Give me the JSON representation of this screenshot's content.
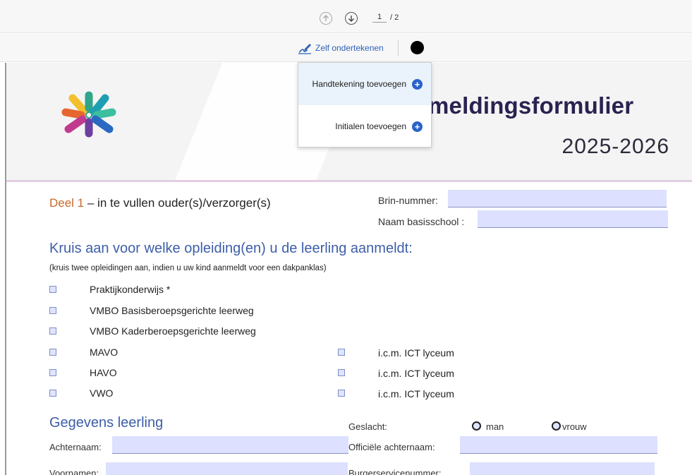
{
  "toolbar": {
    "page_current": "1",
    "page_total": "/ 2",
    "sign_label": "Zelf ondertekenen",
    "ink_color": "#000000"
  },
  "sign_menu": {
    "items": [
      {
        "label": "Handtekening toevoegen"
      },
      {
        "label": "Initialen toevoegen"
      }
    ]
  },
  "document": {
    "title": "meldingsformulier",
    "year": "2025-2026",
    "deel_prefix": "Deel 1",
    "deel_rest": " – in te vullen ouder(s)/verzorger(s)",
    "brin_label": "Brin-nummer:",
    "school_label": "Naam basisschool :",
    "heading_opleiding": "Kruis aan voor welke opleiding(en) u de leerling aanmeldt:",
    "note": "(kruis twee opleidingen aan, indien u uw kind aanmeldt voor een dakpanklas)",
    "options": [
      "Praktijkonderwijs  *",
      "VMBO Basisberoepsgerichte leerweg",
      "VMBO Kaderberoepsgerichte leerweg",
      "MAVO",
      "HAVO",
      "VWO"
    ],
    "ict_label": "i.c.m. ICT lyceum",
    "heading_leerling": "Gegevens leerling",
    "geslacht_label": "Geslacht:",
    "radio_man": "man",
    "radio_vrouw": "vrouw",
    "achternaam_label": "Achternaam:",
    "officiele_label": "Officiële achternaam:",
    "voornamen_label": "Voornamen:",
    "bsn_label": "Burgerservicenummer:"
  },
  "colors": {
    "accent_blue": "#3d5ea8",
    "accent_orange": "#c8692a",
    "field_fill": "#dde1ff",
    "title_color": "#2a2250"
  }
}
